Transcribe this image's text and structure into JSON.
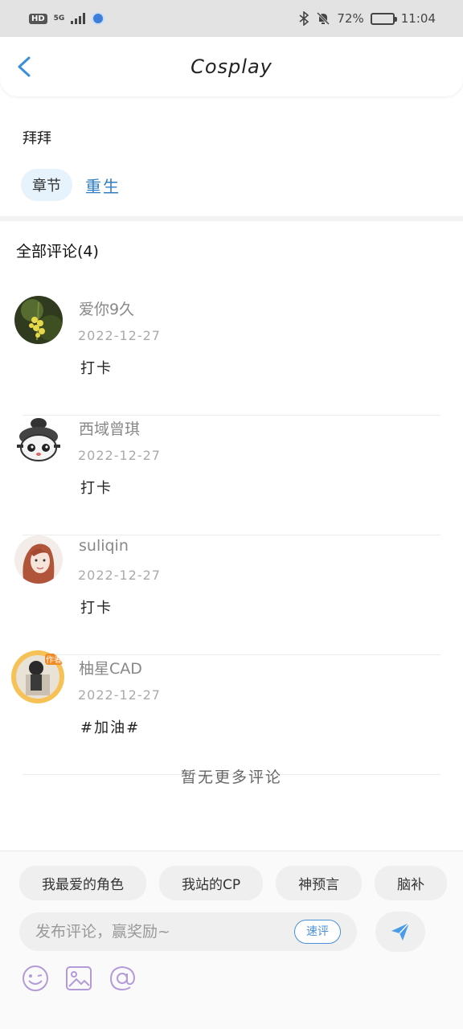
{
  "status_bar": {
    "hd": "HD",
    "network": "5G",
    "battery_percent": "72%",
    "time": "11:04",
    "battery_level": 0.72
  },
  "header": {
    "title": "Cosplay"
  },
  "intro": {
    "text": "拜拜",
    "chapter_chip": "章节",
    "chapter_name": "重生"
  },
  "comments_section": {
    "title": "全部评论(4)",
    "no_more": "暂无更多评论"
  },
  "comments": [
    {
      "user": "爱你9久",
      "date": "2022-12-27",
      "body": "打卡",
      "avatar_icon": "flower-avatar"
    },
    {
      "user": "西域曾琪",
      "date": "2022-12-27",
      "body": "打卡",
      "avatar_icon": "cartoon-avatar"
    },
    {
      "user": "suliqin",
      "date": "2022-12-27",
      "body": "打卡",
      "avatar_icon": "photo-avatar"
    },
    {
      "user": "柚星CAD",
      "date": "2022-12-27",
      "body": "#加油#",
      "avatar_icon": "author-avatar",
      "badge": "作者"
    }
  ],
  "composer": {
    "quick_tags": [
      "我最爱的角色",
      "我站的CP",
      "神预言",
      "脑补"
    ],
    "placeholder": "发布评论，赢奖励~",
    "quick_review": "速评"
  },
  "colors": {
    "accent": "#2e7dc6",
    "send": "#4a9be8",
    "tool_icons": "#b39ad8"
  }
}
